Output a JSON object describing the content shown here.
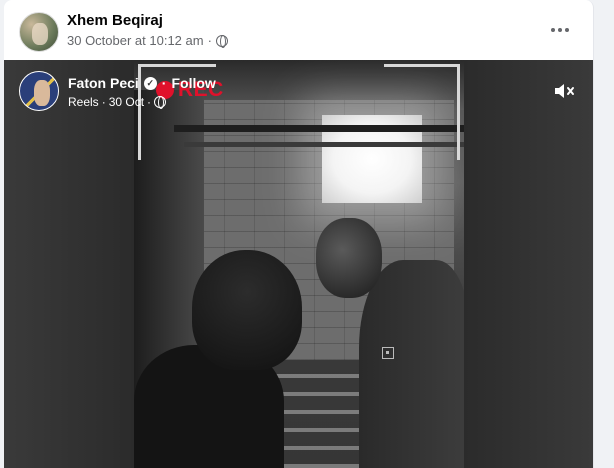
{
  "post": {
    "author": "Xhem Beqiraj",
    "date": "30 October at 10:12 am",
    "separator": "·"
  },
  "reel": {
    "author": "Faton Peci",
    "follow_separator": "·",
    "follow_label": "Follow",
    "source": "Reels",
    "meta_separator": "·",
    "date": "30 Oct",
    "date_separator": "·"
  },
  "video": {
    "overlay_text": "REC"
  },
  "colors": {
    "rec": "#e0112b",
    "text_secondary": "#65676b"
  },
  "icons": {
    "audience": "globe-icon",
    "more": "more-options-icon",
    "verified": "verified-badge-icon",
    "mute": "muted-speaker-icon"
  }
}
